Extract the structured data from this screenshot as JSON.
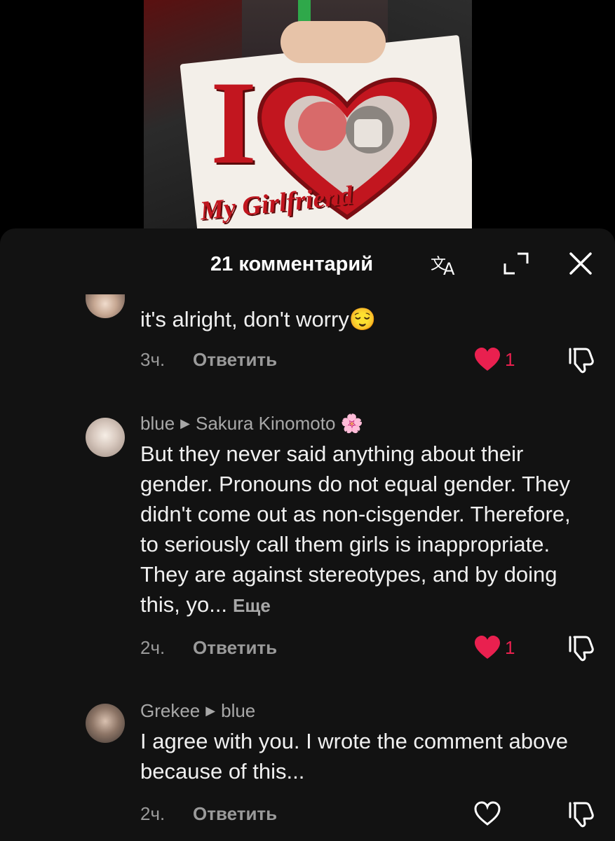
{
  "video": {
    "sign_letter": "I",
    "sign_caption": "My Girlfriend"
  },
  "header": {
    "title": "21 комментарий",
    "translate_icon": "translate-icon",
    "expand_icon": "expand-icon",
    "close_icon": "close-icon"
  },
  "comments": [
    {
      "text": "it's alright, don't worry😌",
      "time": "3ч.",
      "reply_label": "Ответить",
      "liked": true,
      "like_count": "1"
    },
    {
      "author": "blue",
      "reply_to": "Sakura Kinomoto 🌸",
      "text": "But they never said anything about their gender. Pronouns do not equal gender. They didn't come out as non-cisgender. Therefore, to seriously call them girls is inappropriate. They are against stereotypes, and by doing this, yo...",
      "more_label": "Еще",
      "time": "2ч.",
      "reply_label": "Ответить",
      "liked": true,
      "like_count": "1"
    },
    {
      "author": "Grekee",
      "reply_to": "blue",
      "text": "I agree with you. I wrote the comment above because of this...",
      "time": "2ч.",
      "reply_label": "Ответить",
      "liked": false,
      "like_count": ""
    }
  ],
  "colors": {
    "sheet_bg": "#121212",
    "like_red": "#e9204f",
    "secondary_text": "#a8a8a8"
  }
}
